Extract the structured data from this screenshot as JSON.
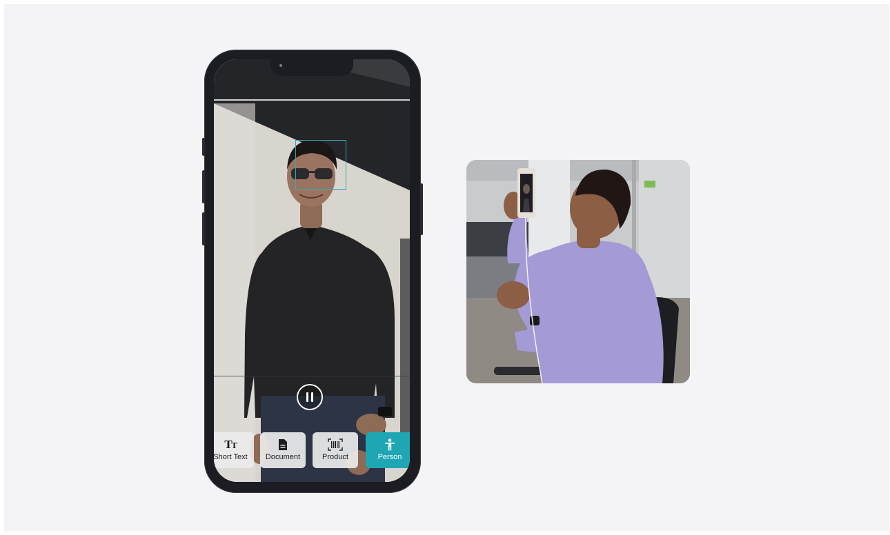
{
  "phone": {
    "modes": [
      {
        "label": "Short Text",
        "icon": "text-size-icon",
        "selected": false
      },
      {
        "label": "Document",
        "icon": "document-icon",
        "selected": false
      },
      {
        "label": "Product",
        "icon": "barcode-icon",
        "selected": false
      },
      {
        "label": "Person",
        "icon": "person-icon",
        "selected": true
      }
    ],
    "pause_icon": "pause-icon",
    "accent_color": "#1fa6b4",
    "face_box_color": "#35a8b8"
  },
  "photo": {
    "subject": "person-holding-phone-photo"
  }
}
